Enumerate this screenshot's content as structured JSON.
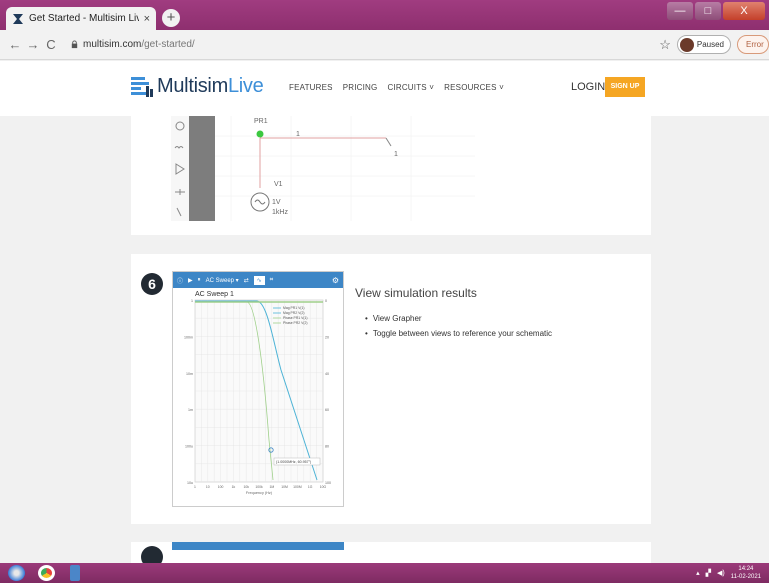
{
  "browser": {
    "tab_title": "Get Started - Multisim Liv",
    "tab_close": "×",
    "new_tab": "+",
    "back": "←",
    "forward": "→",
    "reload": "C",
    "url_host": "multisim.com",
    "url_path": "/get-started/",
    "star": "☆",
    "profile_status": "Paused",
    "error_chip": "Error",
    "win_minimize": "—",
    "win_maximize": "□",
    "win_close": "X"
  },
  "site": {
    "logo_main": "Multisim",
    "logo_accent": "Live",
    "nav": [
      "FEATURES",
      "PRICING",
      "CIRCUITS",
      "RESOURCES"
    ],
    "login": "LOGIN",
    "signup": "SIGN UP"
  },
  "schematic": {
    "probe_label": "PR1",
    "wire_label_1": "1",
    "wire_label_2": "1",
    "source_label": "V1",
    "source_voltage": "1V",
    "source_freq": "1kHz"
  },
  "step6": {
    "number": "6",
    "grapher_mode": "AC Sweep",
    "grapher_title": "AC Sweep 1",
    "heading": "View simulation results",
    "bullets": [
      "View Grapher",
      "Toggle between views to reference your schematic"
    ],
    "cursor_readout": "(1.0000MHz, 60.957°)",
    "x_axis_label": "Frequency (Hz)",
    "legend": [
      "Mag PR1 V(1)",
      "Mag PR2 V(2)",
      "Phase PR1 V(1)",
      "Phase PR2 V(2)"
    ],
    "y_ticks_left": [
      "1",
      "100m",
      "10m",
      "1m",
      "100u",
      "10u"
    ],
    "y_ticks_right": [
      "0",
      "20",
      "40",
      "60",
      "80",
      "100"
    ],
    "x_ticks": [
      "1",
      "10",
      "100",
      "1k",
      "10k",
      "100k",
      "1M",
      "10M",
      "100M",
      "1G",
      "10G"
    ],
    "colors": {
      "mag": "#4db3d6",
      "phase": "#9fd08a",
      "cursor": "#3d86c6"
    }
  },
  "taskbar": {
    "time": "14:24",
    "date": "11-02-2021"
  }
}
